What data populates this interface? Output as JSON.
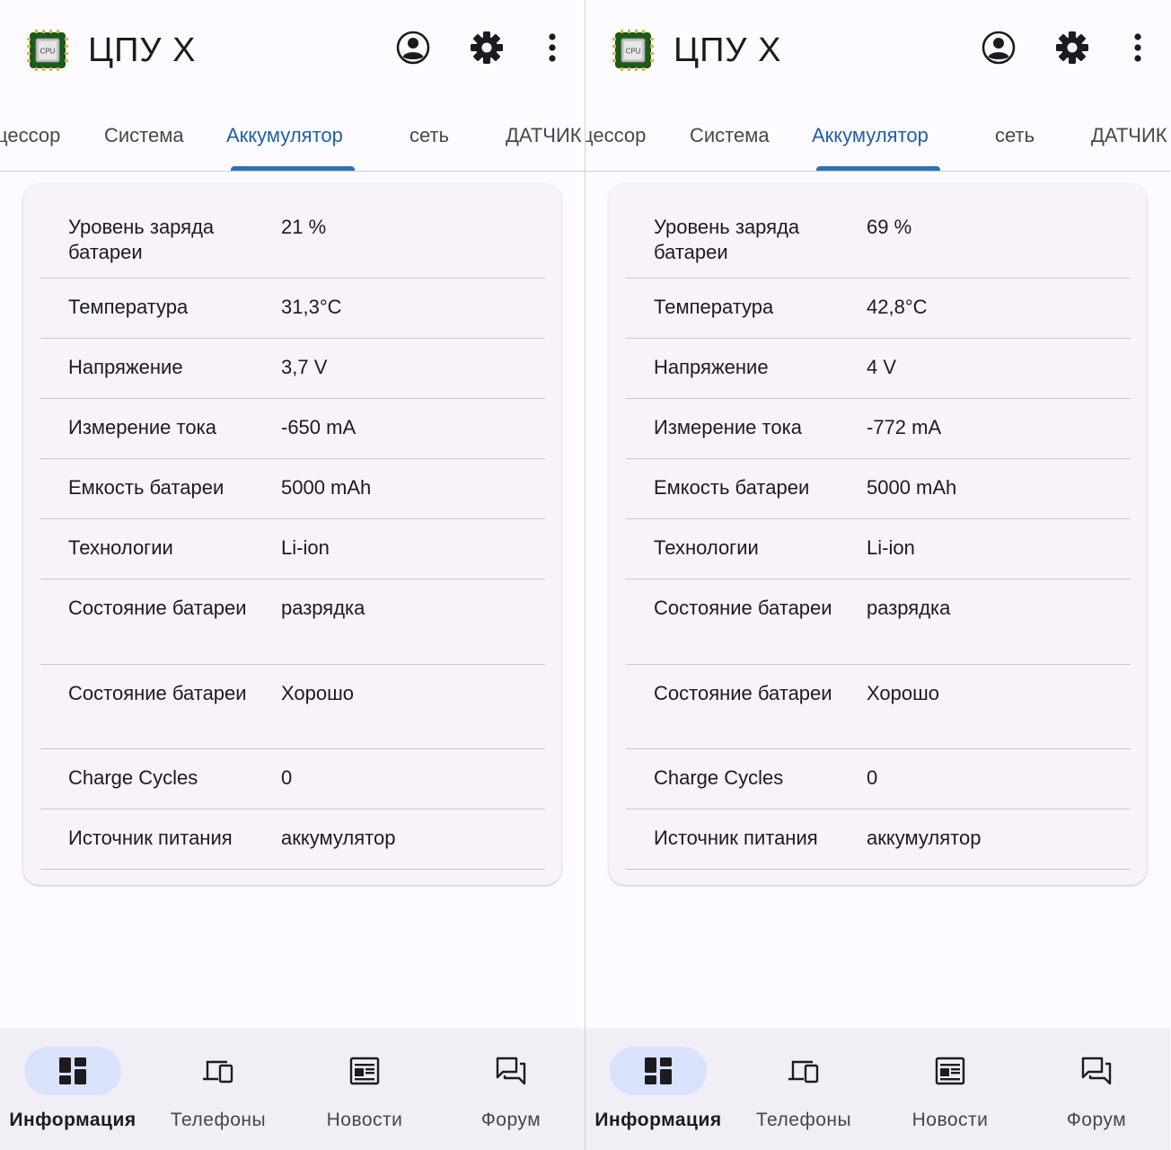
{
  "colors": {
    "accent": "#1f5fa8",
    "tab_indicator": "#2f70b8",
    "nav_active_pill": "#d8e2fb",
    "card_background": "#f7f3f8",
    "bottom_nav_background": "#f2eef6"
  },
  "panels": [
    {
      "appbar": {
        "logo_icon": "cpu-chip-icon",
        "logo_text": "CPU",
        "title": "ЦПУ X",
        "actions": [
          "account-circle-icon",
          "settings-gear-icon",
          "more-vert-icon"
        ]
      },
      "tabs": [
        {
          "label": "цессор",
          "active": false
        },
        {
          "label": "Система",
          "active": false
        },
        {
          "label": "Аккумулятор",
          "active": true
        },
        {
          "label": "сеть",
          "active": false
        },
        {
          "label": "ДАТЧИК",
          "active": false
        }
      ],
      "battery_rows": [
        {
          "label": "Уровень заряда батареи",
          "value": "21 %"
        },
        {
          "label": "Температура",
          "value": "31,3°C"
        },
        {
          "label": "Напряжение",
          "value": "3,7 V"
        },
        {
          "label": "Измерение тока",
          "value": "-650 mA"
        },
        {
          "label": "Емкость батареи",
          "value": "5000 mAh"
        },
        {
          "label": "Технологии",
          "value": "Li-ion"
        },
        {
          "label": "Состояние батареи",
          "value": "разрядка"
        },
        {
          "label": "Состояние батареи",
          "value": "Хорошо"
        },
        {
          "label": "Charge Cycles",
          "value": "0"
        },
        {
          "label": "Источник питания",
          "value": "аккумулятор"
        }
      ],
      "bottom_nav": [
        {
          "label": "Информация",
          "icon": "dashboard-icon",
          "active": true
        },
        {
          "label": "Телефоны",
          "icon": "devices-icon",
          "active": false
        },
        {
          "label": "Новости",
          "icon": "newspaper-icon",
          "active": false
        },
        {
          "label": "Форум",
          "icon": "forum-icon",
          "active": false
        }
      ]
    },
    {
      "appbar": {
        "logo_icon": "cpu-chip-icon",
        "logo_text": "CPU",
        "title": "ЦПУ X",
        "actions": [
          "account-circle-icon",
          "settings-gear-icon",
          "more-vert-icon"
        ]
      },
      "tabs": [
        {
          "label": "цессор",
          "active": false
        },
        {
          "label": "Система",
          "active": false
        },
        {
          "label": "Аккумулятор",
          "active": true
        },
        {
          "label": "сеть",
          "active": false
        },
        {
          "label": "ДАТЧИК",
          "active": false
        }
      ],
      "battery_rows": [
        {
          "label": "Уровень заряда батареи",
          "value": "69 %"
        },
        {
          "label": "Температура",
          "value": "42,8°C"
        },
        {
          "label": "Напряжение",
          "value": "4 V"
        },
        {
          "label": "Измерение тока",
          "value": "-772 mA"
        },
        {
          "label": "Емкость батареи",
          "value": "5000 mAh"
        },
        {
          "label": "Технологии",
          "value": "Li-ion"
        },
        {
          "label": "Состояние батареи",
          "value": "разрядка"
        },
        {
          "label": "Состояние батареи",
          "value": "Хорошо"
        },
        {
          "label": "Charge Cycles",
          "value": "0"
        },
        {
          "label": "Источник питания",
          "value": "аккумулятор"
        }
      ],
      "bottom_nav": [
        {
          "label": "Информация",
          "icon": "dashboard-icon",
          "active": true
        },
        {
          "label": "Телефоны",
          "icon": "devices-icon",
          "active": false
        },
        {
          "label": "Новости",
          "icon": "newspaper-icon",
          "active": false
        },
        {
          "label": "Форум",
          "icon": "forum-icon",
          "active": false
        }
      ]
    }
  ]
}
